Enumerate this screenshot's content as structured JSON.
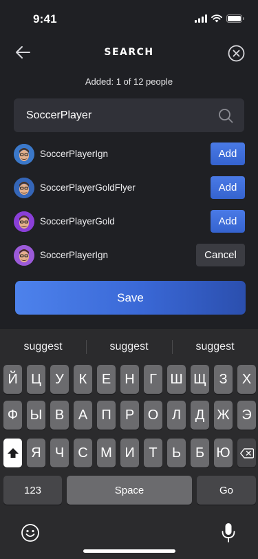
{
  "status_bar": {
    "time": "9:41",
    "icons": [
      "cellular-signal-icon",
      "wifi-icon",
      "battery-icon"
    ]
  },
  "header": {
    "title": "SEARCH",
    "back_icon": "arrow-left-icon",
    "close_icon": "close-circle-icon"
  },
  "added_count": "Added: 1 of 12 people",
  "search": {
    "value": "SoccerPlayer",
    "placeholder": "",
    "icon": "search-icon"
  },
  "results": [
    {
      "name": "SoccerPlayerIgn",
      "action": "Add"
    },
    {
      "name": "SoccerPlayerGoldFlyer",
      "action": "Add"
    },
    {
      "name": "SoccerPlayerGold",
      "action": "Add"
    },
    {
      "name": "SoccerPlayerIgn",
      "action": "Cancel"
    }
  ],
  "save_label": "Save",
  "keyboard": {
    "suggestions": [
      "suggest",
      "suggest",
      "suggest"
    ],
    "row1": [
      "Й",
      "Ц",
      "У",
      "К",
      "Е",
      "Н",
      "Г",
      "Ш",
      "Щ",
      "З",
      "Х"
    ],
    "row2": [
      "Ф",
      "Ы",
      "В",
      "А",
      "П",
      "Р",
      "О",
      "Л",
      "Д",
      "Ж",
      "Э"
    ],
    "row3": [
      "Я",
      "Ч",
      "С",
      "М",
      "И",
      "Т",
      "Ь",
      "Б",
      "Ю"
    ],
    "numbers_key": "123",
    "space_key": "Space",
    "go_key": "Go",
    "shift_icon": "shift-icon",
    "delete_icon": "backspace-icon",
    "emoji_icon": "emoji-icon",
    "mic_icon": "microphone-icon"
  },
  "colors": {
    "background": "#1f2024",
    "accent": "#3f6fdd",
    "input_bg": "#303138",
    "keyboard_bg": "#2b2b2d",
    "key_bg": "#6b6b6e"
  }
}
